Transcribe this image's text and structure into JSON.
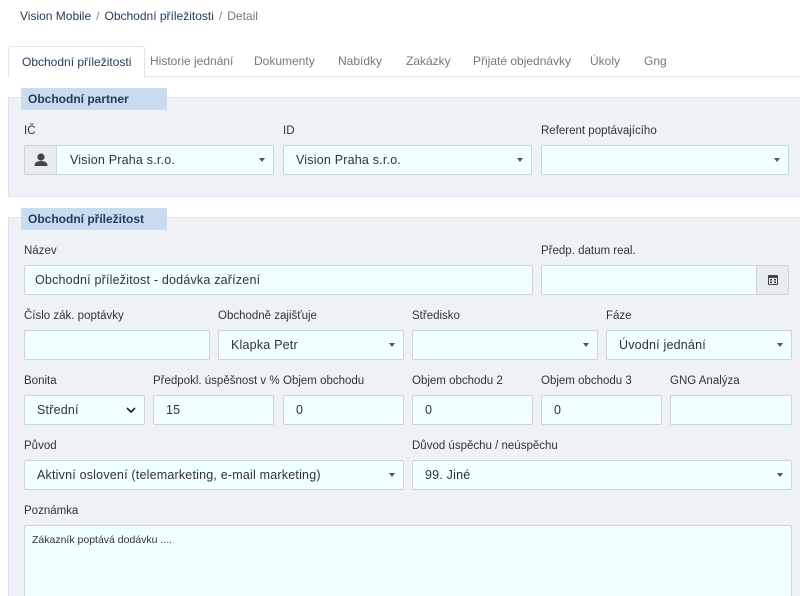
{
  "breadcrumb": {
    "items": [
      "Vision Mobile",
      "Obchodní příležitosti"
    ],
    "current": "Detail",
    "separator": "/"
  },
  "tabs": [
    {
      "label": "Obchodní příležitosti",
      "active": true
    },
    {
      "label": "Historie jednání"
    },
    {
      "label": "Dokumenty"
    },
    {
      "label": "Nabídky"
    },
    {
      "label": "Zakázky"
    },
    {
      "label": "Přijaté objednávky"
    },
    {
      "label": "Úkoly"
    },
    {
      "label": "Gng"
    }
  ],
  "partner": {
    "title": "Obchodní partner",
    "ic_label": "IČ",
    "ic_value": "Vision Praha s.r.o.",
    "id_label": "ID",
    "id_value": "Vision Praha s.r.o.",
    "referent_label": "Referent poptávajícího",
    "referent_value": ""
  },
  "opportunity": {
    "title": "Obchodní příležitost",
    "nazev_label": "Název",
    "nazev_value": "Obchodní příležitost - dodávka zařízení",
    "datum_label": "Předp. datum real.",
    "datum_value": "",
    "cislo_label": "Číslo zák. poptávky",
    "cislo_value": "",
    "zajistuje_label": "Obchodně zajišťuje",
    "zajistuje_value": "Klapka Petr",
    "stredisko_label": "Středisko",
    "stredisko_value": "",
    "faze_label": "Fáze",
    "faze_value": "Úvodní jednání",
    "bonita_label": "Bonita",
    "bonita_value": "Střední",
    "uspesnost_label": "Předpokl. úspěšnost v %",
    "uspesnost_value": "15",
    "objem_label": "Objem obchodu",
    "objem_value": "0",
    "objem2_label": "Objem obchodu 2",
    "objem2_value": "0",
    "objem3_label": "Objem obchodu 3",
    "objem3_value": "0",
    "gng_label": "GNG Analýza",
    "gng_value": "",
    "puvod_label": "Původ",
    "puvod_value": "Aktivní oslovení (telemarketing, e-mail marketing)",
    "duvod_label": "Důvod úspěchu / neúspěchu",
    "duvod_value": "99. Jiné",
    "poznamka_label": "Poznámka",
    "poznamka_value": "Zákazník poptává dodávku ...."
  },
  "colors": {
    "input_bg": "#f0ffff",
    "panel_bg": "#eef1f5",
    "panel_head_bg": "#c9dcef",
    "link": "#1f3a5a"
  },
  "icons": {
    "partner_addon": "user-icon",
    "datum_addon": "calendar-icon"
  }
}
